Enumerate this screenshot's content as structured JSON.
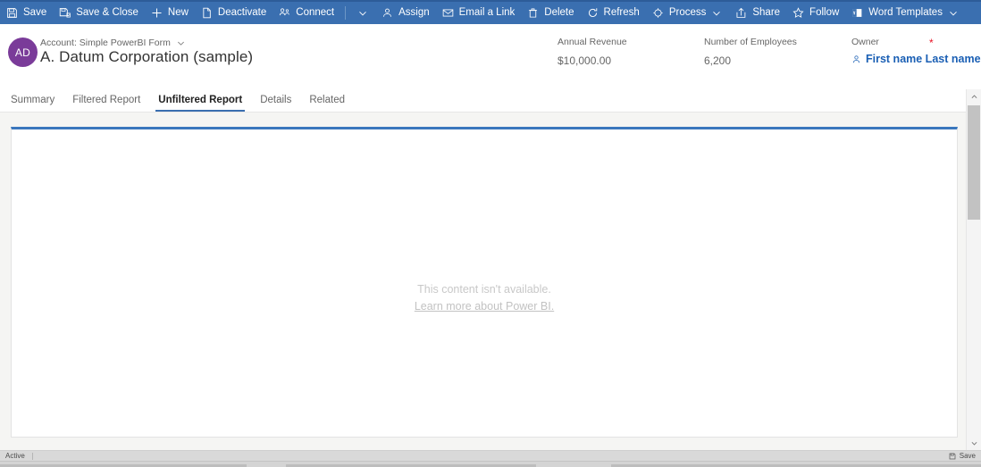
{
  "command_bar": {
    "background": "#3a6fb0",
    "items": [
      {
        "icon": "save-icon",
        "label": "Save",
        "chevron": false
      },
      {
        "icon": "save-and-close-icon",
        "label": "Save & Close",
        "chevron": false
      },
      {
        "icon": "plus-icon",
        "label": "New",
        "chevron": false
      },
      {
        "icon": "deactivate-icon",
        "label": "Deactivate",
        "chevron": false
      },
      {
        "icon": "connect-icon",
        "label": "Connect",
        "chevron": false
      },
      {
        "icon": "split-chevron-icon",
        "label": "",
        "chevron": true,
        "separator": true
      },
      {
        "icon": "assign-icon",
        "label": "Assign",
        "chevron": false
      },
      {
        "icon": "email-a-link-icon",
        "label": "Email a Link",
        "chevron": false
      },
      {
        "icon": "delete-icon",
        "label": "Delete",
        "chevron": false
      },
      {
        "icon": "refresh-icon",
        "label": "Refresh",
        "chevron": false
      },
      {
        "icon": "process-icon",
        "label": "Process",
        "chevron": true
      },
      {
        "icon": "share-icon",
        "label": "Share",
        "chevron": false
      },
      {
        "icon": "follow-star-icon",
        "label": "Follow",
        "chevron": false
      },
      {
        "icon": "word-templates-icon",
        "label": "Word Templates",
        "chevron": true
      }
    ]
  },
  "record_header": {
    "avatar_initials": "AD",
    "avatar_color": "#7a3b99",
    "form_selector_label": "Account: Simple PowerBI Form",
    "record_title": "A. Datum Corporation (sample)",
    "fields": [
      {
        "label": "Annual Revenue",
        "value": "$10,000.00"
      },
      {
        "label": "Number of Employees",
        "value": "6,200"
      }
    ],
    "owner": {
      "label": "Owner",
      "required_marker": "*",
      "required_color": "#e81123",
      "value": "First name Last name",
      "value_color": "#1a5fb4"
    }
  },
  "tabs": {
    "accent_color": "#3a6fb0",
    "items": [
      {
        "label": "Summary",
        "active": false
      },
      {
        "label": "Filtered Report",
        "active": false
      },
      {
        "label": "Unfiltered Report",
        "active": true
      },
      {
        "label": "Details",
        "active": false
      },
      {
        "label": "Related",
        "active": false
      }
    ]
  },
  "content_panel": {
    "top_border_color": "#3a77bd",
    "message": "This content isn't available.",
    "link_label": "Learn more about Power BI."
  },
  "scrollbar": {
    "up_arrow": "chevron-up-icon",
    "down_arrow": "chevron-down-icon"
  },
  "status_bar": {
    "state": "Active",
    "save_label": "Save",
    "save_icon": "save-icon"
  }
}
